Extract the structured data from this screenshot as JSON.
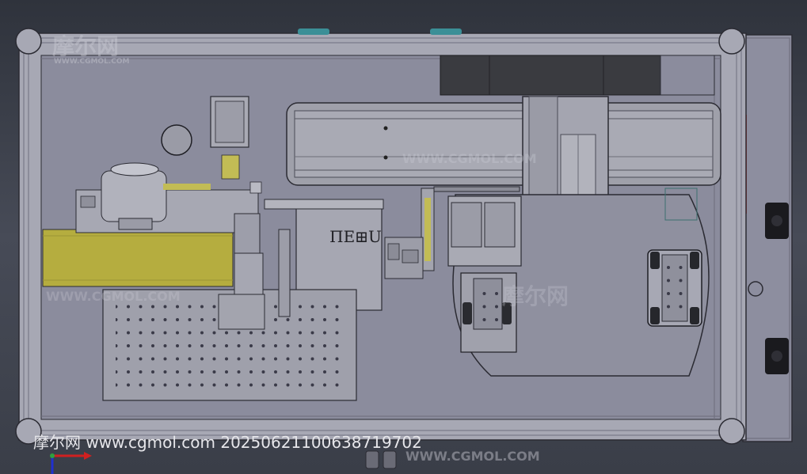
{
  "watermarks": {
    "brand_top_left": "摩尔网",
    "url_top_left": "WWW.CGMOL.COM",
    "url_center": "WWW.CGMOL.COM",
    "url_left": "WWW.CGMOL.COM",
    "brand_center": "摩尔网",
    "url_bottom": "WWW.CGMOL.COM"
  },
  "caption": {
    "text": "摩尔网 www.cgmol.com 20250621100638719702"
  },
  "machine": {
    "label_plate": "ΠΕ⊞U"
  },
  "colors": {
    "background": "#3e424d",
    "frame": "#a9a9b4",
    "panel": "#8c8d9e",
    "tape_roll": "#b5ad3f",
    "alarm_strip": "#c0352f"
  },
  "view_axes": {
    "x_axis_color": "#d02020",
    "y_axis_color": "#2030d0"
  }
}
